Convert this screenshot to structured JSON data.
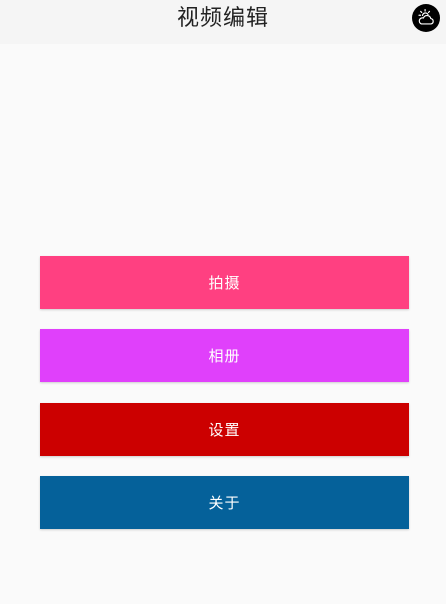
{
  "app_bar": {
    "title": "视频编辑",
    "action_icon": "weather-partly-cloudy-icon"
  },
  "menu": {
    "buttons": [
      {
        "label": "拍摄",
        "color": "#ff4081"
      },
      {
        "label": "相册",
        "color": "#e040fb"
      },
      {
        "label": "设置",
        "color": "#cc0000"
      },
      {
        "label": "关于",
        "color": "#05619a"
      }
    ]
  },
  "colors": {
    "background": "#fafafa",
    "app_bar": "#f5f5f5",
    "button_text": "#ffffff"
  }
}
